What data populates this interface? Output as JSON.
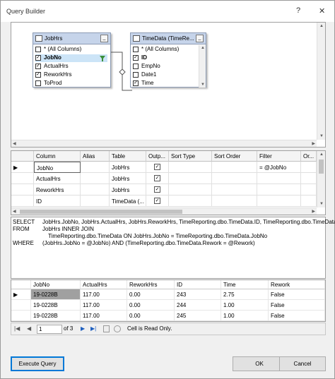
{
  "window": {
    "title": "Query Builder",
    "help": "?",
    "close": "✕"
  },
  "diagram": {
    "jobhrs": {
      "name": "JobHrs",
      "columns": [
        {
          "label": "* (All Columns)",
          "checked": false
        },
        {
          "label": "JobNo",
          "checked": true
        },
        {
          "label": "ActualHrs",
          "checked": true
        },
        {
          "label": "ReworkHrs",
          "checked": true
        },
        {
          "label": "ToProd",
          "checked": false
        }
      ]
    },
    "timedata": {
      "name": "TimeData (TimeRe...",
      "columns": [
        {
          "label": "* (All Columns)",
          "checked": false
        },
        {
          "label": "ID",
          "checked": true
        },
        {
          "label": "EmpNo",
          "checked": false
        },
        {
          "label": "Date1",
          "checked": false
        },
        {
          "label": "Time",
          "checked": true
        }
      ]
    },
    "min_label": "_"
  },
  "grid": {
    "headers": [
      "Column",
      "Alias",
      "Table",
      "Outp...",
      "Sort Type",
      "Sort Order",
      "Filter",
      "Or..."
    ],
    "rows": [
      {
        "column": "JobNo",
        "alias": "",
        "table": "JobHrs",
        "output": true,
        "filter": "= @JobNo"
      },
      {
        "column": "ActualHrs",
        "alias": "",
        "table": "JobHrs",
        "output": true,
        "filter": ""
      },
      {
        "column": "ReworkHrs",
        "alias": "",
        "table": "JobHrs",
        "output": true,
        "filter": ""
      },
      {
        "column": "ID",
        "alias": "",
        "table": "TimeData (...",
        "output": true,
        "filter": ""
      }
    ],
    "row_marker": "▶"
  },
  "sql": {
    "select_kw": "SELECT",
    "select_text": "JobHrs.JobNo, JobHrs.ActualHrs, JobHrs.ReworkHrs, TimeReporting.dbo.TimeData.ID, TimeReporting.dbo.TimeData",
    "from_kw": "FROM",
    "from_text": "JobHrs INNER JOIN",
    "join_text": "TimeReporting.dbo.TimeData ON JobHrs.JobNo = TimeReporting.dbo.TimeData.JobNo",
    "where_kw": "WHERE",
    "where_text": "(JobHrs.JobNo = @JobNo) AND (TimeReporting.dbo.TimeData.Rework = @Rework)"
  },
  "results": {
    "headers": [
      "JobNo",
      "ActualHrs",
      "ReworkHrs",
      "ID",
      "Time",
      "Rework"
    ],
    "rows": [
      [
        "19-0228B",
        "117.00",
        "0.00",
        "243",
        "2.75",
        "False"
      ],
      [
        "19-0228B",
        "117.00",
        "0.00",
        "244",
        "1.00",
        "False"
      ],
      [
        "19-0228B",
        "117.00",
        "0.00",
        "245",
        "1.00",
        "False"
      ]
    ]
  },
  "nav": {
    "first": "|◀",
    "prev": "◀",
    "position": "1",
    "of_total": "of 3",
    "next": "▶",
    "last": "▶|",
    "status": "Cell is Read Only."
  },
  "buttons": {
    "execute": "Execute Query",
    "ok": "OK",
    "cancel": "Cancel"
  }
}
